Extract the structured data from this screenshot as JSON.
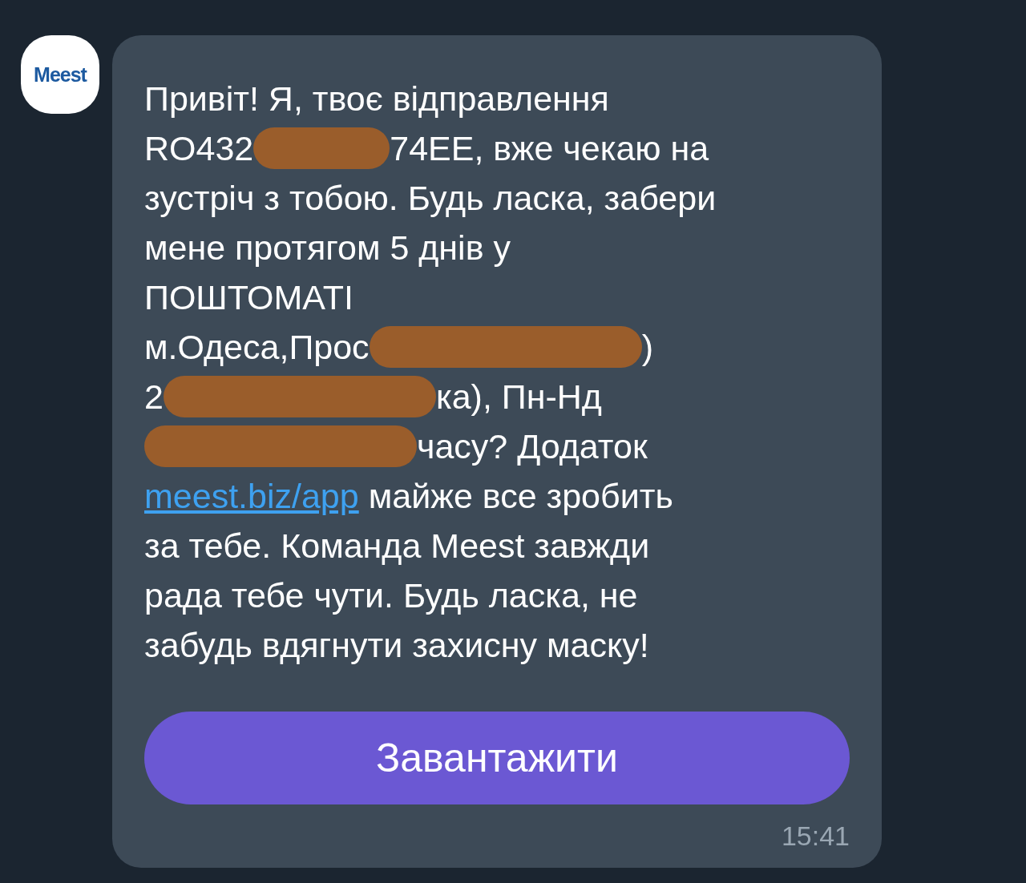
{
  "sender": {
    "logo": "Meest"
  },
  "message": {
    "lines": [
      [
        {
          "kind": "text",
          "text": "Привіт! Я, твоє відправлення"
        }
      ],
      [
        {
          "kind": "text",
          "text": "RO432"
        },
        {
          "kind": "redaction"
        },
        {
          "kind": "text",
          "text": "74EE, вже чекаю на"
        }
      ],
      [
        {
          "kind": "text",
          "text": "зустріч з тобою. Будь ласка, забери"
        }
      ],
      [
        {
          "kind": "text",
          "text": "мене протягом 5 днів у"
        }
      ],
      [
        {
          "kind": "text",
          "text": "ПОШТОМАТІ"
        }
      ],
      [
        {
          "kind": "text",
          "text": "м.Одеса,Прос"
        },
        {
          "kind": "redaction-long"
        },
        {
          "kind": "text",
          "text": ")"
        }
      ],
      [
        {
          "kind": "text",
          "text": "2"
        },
        {
          "kind": "redaction-long"
        },
        {
          "kind": "text",
          "text": "ка), Пн-Нд"
        }
      ],
      [
        {
          "kind": "redaction-long"
        },
        {
          "kind": "text",
          "text": "часу? Додаток"
        }
      ],
      [
        {
          "kind": "link",
          "text": "meest.biz/app"
        },
        {
          "kind": "text",
          "text": " майже все зробить"
        }
      ],
      [
        {
          "kind": "text",
          "text": "за тебе. Команда Meest завжди"
        }
      ],
      [
        {
          "kind": "text",
          "text": "рада тебе чути. Будь ласка, не"
        }
      ],
      [
        {
          "kind": "text",
          "text": "забудь вдягнути захисну маску!"
        }
      ]
    ],
    "button": "Завантажити",
    "time": "15:41"
  }
}
